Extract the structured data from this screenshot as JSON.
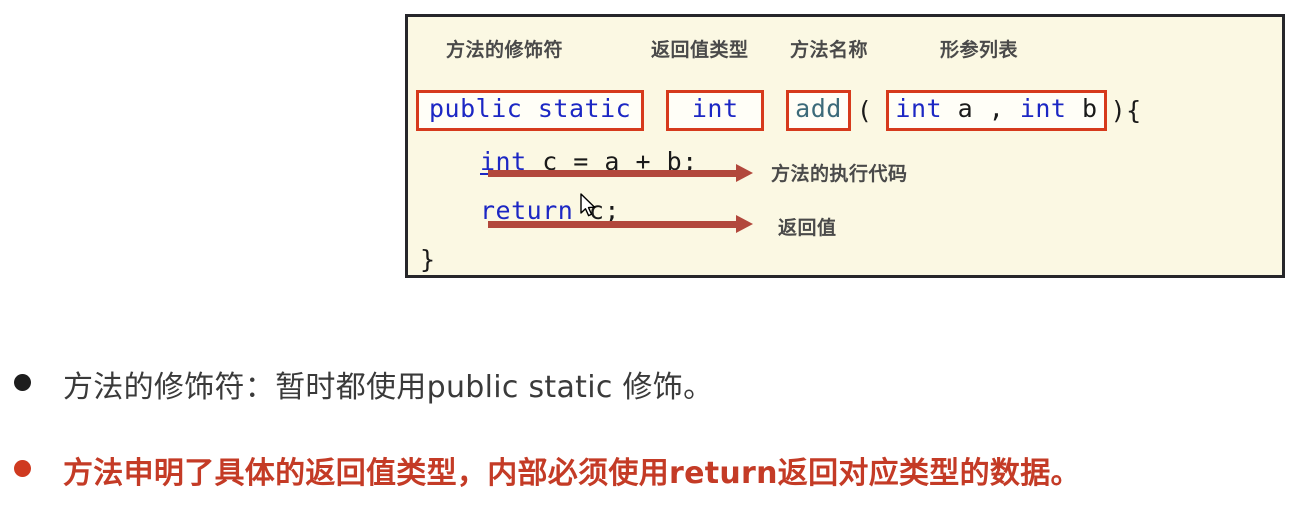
{
  "diagram": {
    "annotation_labels": {
      "modifier": "方法的修饰符",
      "return_type": "返回值类型",
      "method_name": "方法名称",
      "param_list": "形参列表"
    },
    "code": {
      "signature": {
        "modifier": "public static",
        "return_type": "int",
        "method_name": "add",
        "open_paren": "(",
        "params": "int a , int b",
        "close_paren_brace": "){"
      },
      "body_line": {
        "keyword": "int",
        "rest": " c = a + b;"
      },
      "return_line": {
        "keyword": "return",
        "rest": " c;"
      },
      "closing_brace": "}"
    },
    "arrow_labels": {
      "body": "方法的执行代码",
      "return": "返回值"
    },
    "colors": {
      "panel_background": "#fbf8e3",
      "panel_border": "#26262a",
      "highlight_box_border": "#d63a1c",
      "keyword": "#1c27c4",
      "method_name": "#3d6b7a",
      "arrow": "#b2483c",
      "label_text": "#4a4a4a"
    }
  },
  "bullets": [
    {
      "dot_color": "#1d1d1d",
      "text": "方法的修饰符：暂时都使用public static 修饰。",
      "text_color": "#3a3a3a"
    },
    {
      "dot_color": "#cf3a20",
      "text": "方法申明了具体的返回值类型，内部必须使用return返回对应类型的数据。",
      "text_color": "#c43b26"
    }
  ]
}
